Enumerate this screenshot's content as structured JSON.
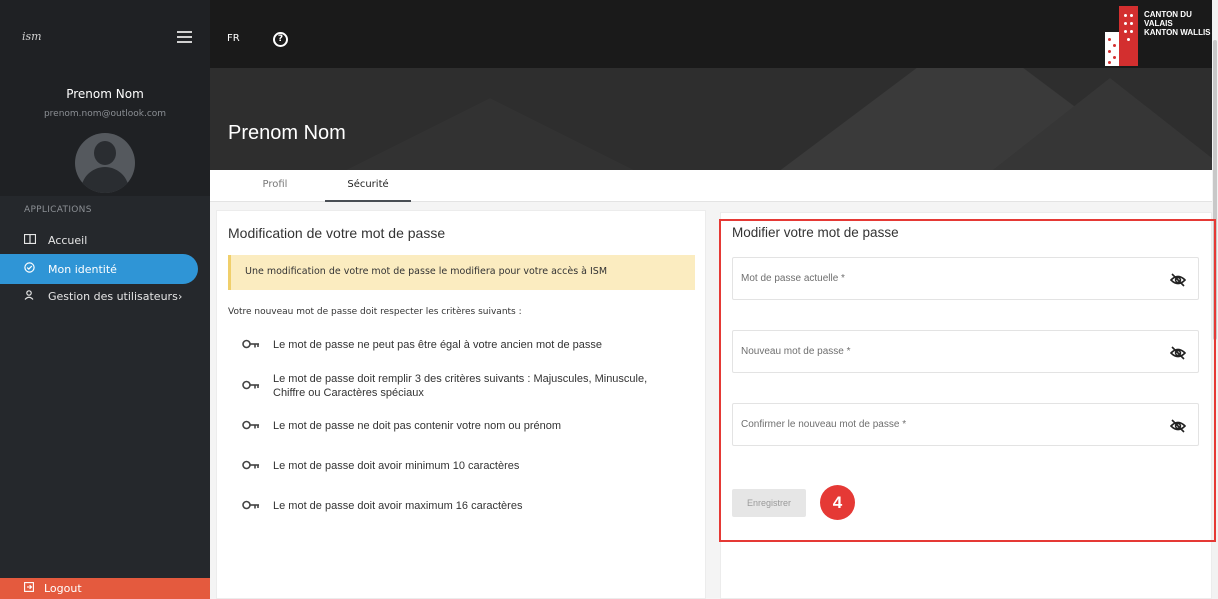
{
  "sidebar": {
    "logo": "ism",
    "user_name": "Prenom Nom",
    "user_email": "prenom.nom@outlook.com",
    "section_label": "APPLICATIONS",
    "items": [
      {
        "label": "Accueil",
        "icon": "book-icon"
      },
      {
        "label": "Mon identité",
        "icon": "shield-check-icon"
      },
      {
        "label": "Gestion des utilisateurs",
        "icon": "user-icon"
      }
    ],
    "logout": "Logout"
  },
  "topbar": {
    "lang": "FR",
    "help_glyph": "?",
    "canton_line1": "CANTON DU VALAIS",
    "canton_line2": "KANTON WALLIS"
  },
  "header": {
    "title": "Prenom Nom"
  },
  "tabs": [
    {
      "label": "Profil"
    },
    {
      "label": "Sécurité"
    }
  ],
  "rules_card": {
    "title": "Modification de votre mot de passe",
    "warning": "Une modification de votre mot de passe le modifiera pour votre accès à ISM",
    "intro": "Votre nouveau mot de passe doit respecter les critères suivants :",
    "rules": [
      "Le mot de passe ne peut pas être égal à votre ancien mot de passe",
      "Le mot de passe doit remplir 3 des critères suivants : Majuscules, Minuscule,",
      "Chiffre ou Caractères spéciaux",
      "Le mot de passe ne doit pas contenir votre nom ou prénom",
      "Le mot de passe doit avoir minimum 10 caractères",
      "Le mot de passe doit avoir maximum 16 caractères"
    ]
  },
  "password_form": {
    "title": "Modifier votre mot de passe",
    "current_placeholder": "Mot de passe actuelle *",
    "new_placeholder": "Nouveau mot de passe *",
    "confirm_placeholder": "Confirmer le nouveau mot de passe *",
    "save_label": "Enregistrer",
    "step_number": "4"
  },
  "colors": {
    "sidebar_bg": "#25282c",
    "active_nav": "#2f95d6",
    "logout_bg": "#e45a3e",
    "highlight": "#e53935",
    "warning_bg": "#fbecc0"
  }
}
